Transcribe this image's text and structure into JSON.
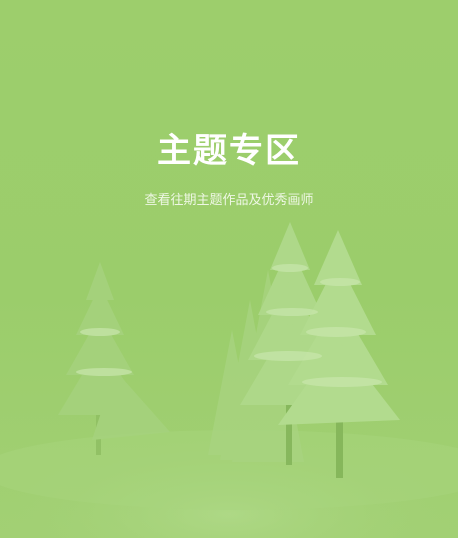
{
  "banner": {
    "title": "主题专区",
    "subtitle": "查看往期主题作品及优秀画师",
    "background_color": "#9bcd6b",
    "tree_color": "#b2db8e",
    "snow_color": "#c9e7ad"
  }
}
